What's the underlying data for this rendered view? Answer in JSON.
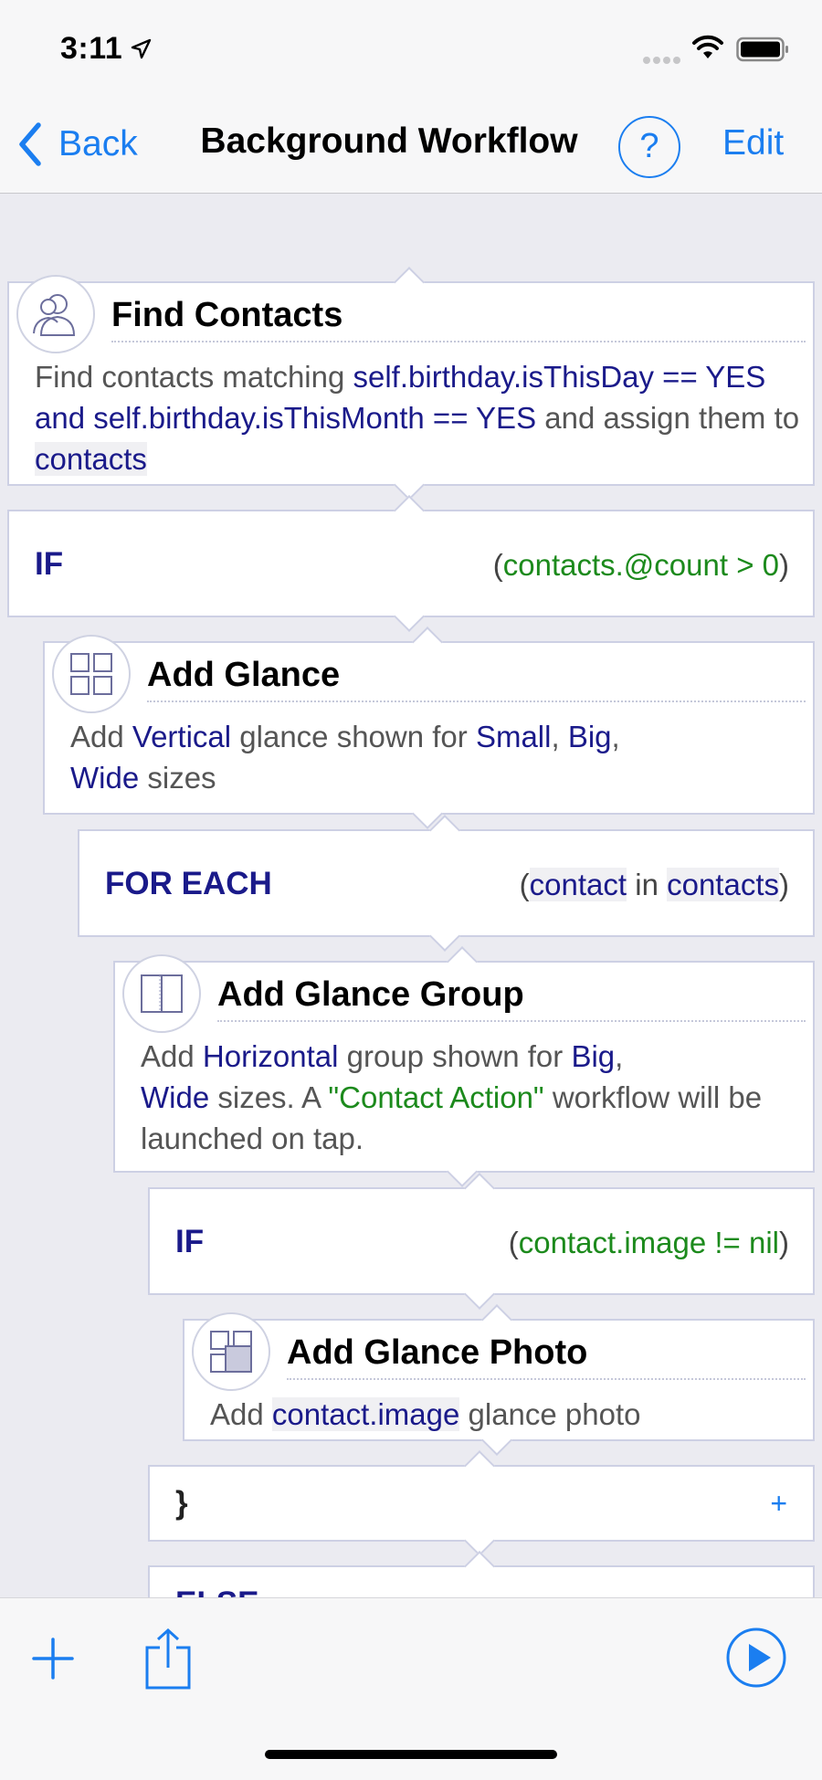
{
  "status_bar": {
    "time": "3:11"
  },
  "nav": {
    "back_label": "Back",
    "title": "Background Workflow",
    "help_label": "?",
    "edit_label": "Edit"
  },
  "blocks": {
    "find_contacts": {
      "title": "Find Contacts",
      "t1": "Find contacts matching ",
      "v1": "self.birthday.isThisDay == YES and self.birthday.isThisMonth == YES",
      "t2": " and assign them to ",
      "v2": "contacts"
    },
    "if1": {
      "label": "IF",
      "cond": "contacts.@count > 0"
    },
    "add_glance": {
      "title": "Add Glance",
      "t1": "Add ",
      "v1": "Vertical",
      "t2": " glance shown for ",
      "v2": "Small",
      "t3": ", ",
      "v3": "Big",
      "t4": ", ",
      "v4": "Wide",
      "t5": " sizes"
    },
    "for_each": {
      "label": "FOR EACH",
      "var": "contact",
      "in": " in ",
      "collection": "contacts"
    },
    "add_glance_group": {
      "title": "Add Glance Group",
      "t1": "Add ",
      "v1": "Horizontal",
      "t2": " group shown for ",
      "v2": "Big",
      "t3": ", ",
      "v3": "Wide",
      "t4": " sizes. A ",
      "v4": "\"Contact Action\"",
      "t5": " workflow will be launched on tap."
    },
    "if2": {
      "label": "IF",
      "cond": "contact.image != nil"
    },
    "add_glance_photo": {
      "title": "Add Glance Photo",
      "t1": "Add ",
      "v1": "contact.image",
      "t2": " glance photo"
    },
    "close_brace": {
      "label": "}",
      "plus": "+"
    },
    "else": {
      "label": "ELSE"
    }
  },
  "colors": {
    "accent": "#1b7ef0",
    "variable": "#1a1a8a",
    "condition": "#1c8a1c",
    "block_border": "#cdd0e4"
  },
  "icons": {
    "find_contacts": "contacts-icon",
    "add_glance": "glance-grid-icon",
    "add_glance_group": "glance-group-icon",
    "add_glance_photo": "glance-photo-icon",
    "toolbar": [
      "add-icon",
      "share-icon",
      "run-icon"
    ]
  }
}
